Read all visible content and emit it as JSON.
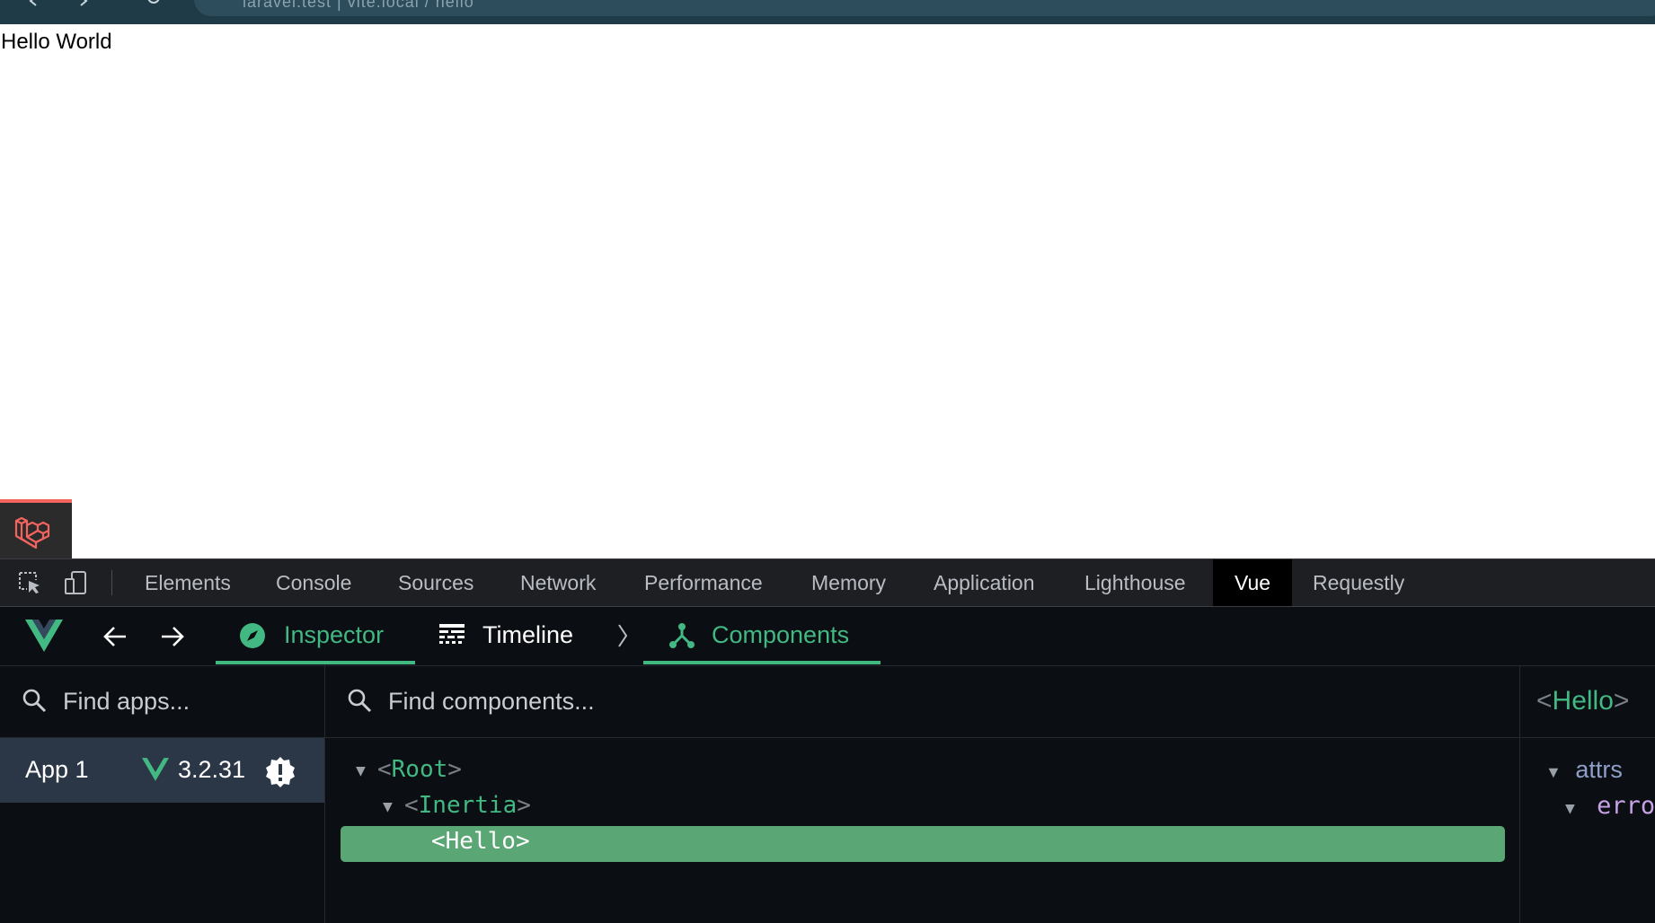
{
  "browser": {
    "address_text": "laravel.test | vite.local / hello"
  },
  "page": {
    "body_text": "Hello World"
  },
  "debugbar": {
    "icon": "laravel-logo-icon",
    "accent_color": "#f4645f"
  },
  "devtools": {
    "tabs": [
      {
        "label": "Elements"
      },
      {
        "label": "Console"
      },
      {
        "label": "Sources"
      },
      {
        "label": "Network"
      },
      {
        "label": "Performance"
      },
      {
        "label": "Memory"
      },
      {
        "label": "Application"
      },
      {
        "label": "Lighthouse"
      },
      {
        "label": "Vue",
        "active": true
      },
      {
        "label": "Requestly"
      }
    ],
    "tools": [
      "inspect-element-icon",
      "device-toggle-icon"
    ]
  },
  "vue": {
    "accent_color": "#42b883",
    "nav": {
      "inspector": "Inspector",
      "timeline": "Timeline",
      "components": "Components"
    },
    "apps": {
      "search_placeholder": "Find apps...",
      "items": [
        {
          "name": "App 1",
          "version": "3.2.31"
        }
      ]
    },
    "components": {
      "search_placeholder": "Find components...",
      "tree": [
        {
          "name": "Root",
          "open": "<",
          "close": ">"
        },
        {
          "name": "Inertia",
          "open": "<",
          "close": ">"
        },
        {
          "name": "Hello",
          "open": "<",
          "close": ">",
          "selected": true
        }
      ]
    },
    "details": {
      "title_open": "<",
      "title_name": "Hello",
      "title_close": ">",
      "section": "attrs",
      "field": "erro"
    }
  }
}
